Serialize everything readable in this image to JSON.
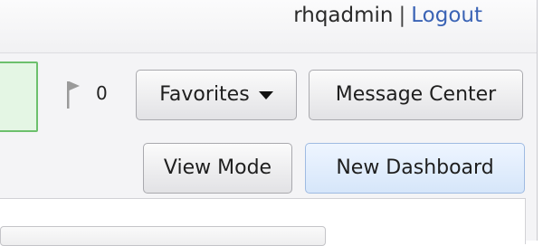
{
  "header": {
    "username": "rhqadmin",
    "separator": "|",
    "logout_label": "Logout"
  },
  "toolbar": {
    "alert_count": "0",
    "favorites_label": "Favorites",
    "message_center_label": "Message Center"
  },
  "dashboard_actions": {
    "view_mode_label": "View Mode",
    "new_dashboard_label": "New Dashboard"
  },
  "icons": {
    "flag": "flag-icon",
    "dropdown": "chevron-down-icon"
  },
  "colors": {
    "link": "#3a63b5",
    "active_tab_border": "#6cc06c",
    "primary_button": "#d6e6fa"
  }
}
